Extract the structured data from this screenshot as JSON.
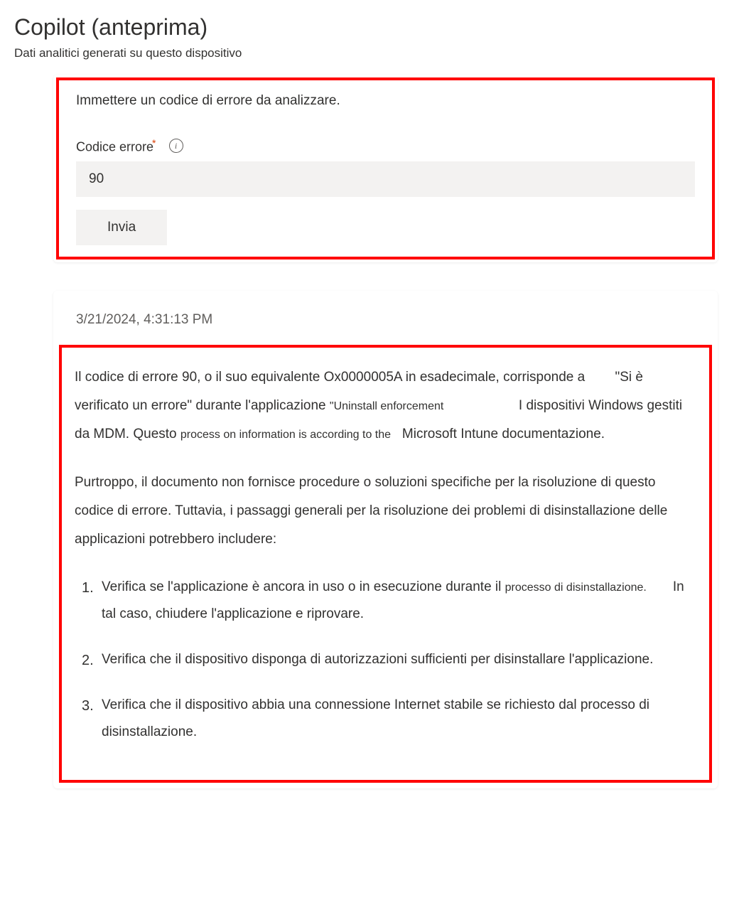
{
  "header": {
    "title": "Copilot (anteprima)",
    "subtitle": "Dati analitici generati su questo dispositivo"
  },
  "input_section": {
    "instruction": "Immettere un codice di errore da analizzare.",
    "field_label": "Codice errore",
    "required_marker": "*",
    "input_value": "90",
    "submit_label": "Invia"
  },
  "result": {
    "timestamp": "3/21/2024, 4:31:13 PM",
    "paragraph1_part1": "Il codice di errore 90, o il suo equivalente Ox0000005A in esadecimale, corrisponde a ",
    "paragraph1_part2": "\"Si è verificato un errore\" durante l'applicazione ",
    "paragraph1_part3": "\"Uninstall enforcement",
    "paragraph1_part4": "I dispositivi Windows gestiti da MDM. Questo ",
    "paragraph1_part5": "process on information is according to the",
    "paragraph1_part6": "Microsoft Intune documentazione.",
    "paragraph2": "Purtroppo, il documento non fornisce procedure o soluzioni specifiche per la risoluzione di questo codice di errore. Tuttavia, i passaggi generali per la risoluzione dei problemi di disinstallazione delle applicazioni potrebbero includere:",
    "list_items": [
      {
        "part1": "Verifica se l'applicazione è ancora in uso o in esecuzione durante il ",
        "part2": "processo di disinstallazione.",
        "part3": "In tal caso, chiudere l'applicazione e riprovare."
      },
      {
        "text": "Verifica che il dispositivo disponga di autorizzazioni sufficienti per disinstallare l'applicazione."
      },
      {
        "text": "Verifica che il dispositivo abbia una connessione Internet stabile se richiesto dal processo di disinstallazione."
      }
    ]
  }
}
